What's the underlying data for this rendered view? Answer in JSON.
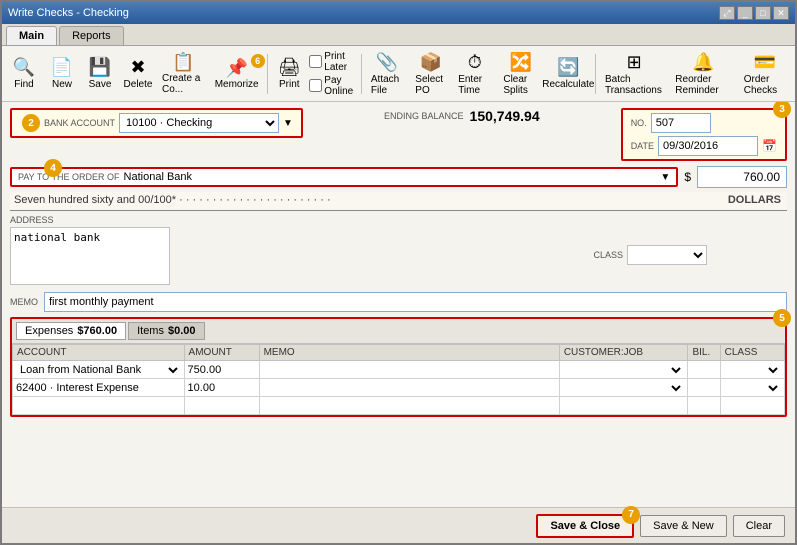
{
  "window": {
    "title": "Write Checks - Checking",
    "controls": [
      "minimize",
      "maximize",
      "close"
    ],
    "expand_icon": "⤢"
  },
  "tabs": [
    {
      "id": "main",
      "label": "Main",
      "active": true
    },
    {
      "id": "reports",
      "label": "Reports",
      "active": false
    }
  ],
  "toolbar": {
    "buttons": [
      {
        "id": "find",
        "label": "Find",
        "icon": "🔍"
      },
      {
        "id": "new",
        "label": "New",
        "icon": "📄"
      },
      {
        "id": "save",
        "label": "Save",
        "icon": "💾"
      },
      {
        "id": "delete",
        "label": "Delete",
        "icon": "✖"
      },
      {
        "id": "create-copy",
        "label": "Create a Co...",
        "icon": "📋"
      },
      {
        "id": "memorize",
        "label": "Memorize",
        "icon": "📌",
        "badge": "6"
      },
      {
        "id": "print",
        "label": "Print",
        "icon": "🖨"
      },
      {
        "id": "print-later",
        "label": "Print Later",
        "icon": ""
      },
      {
        "id": "pay-online",
        "label": "Pay Online",
        "icon": ""
      },
      {
        "id": "attach-file",
        "label": "Attach File",
        "icon": "📎"
      },
      {
        "id": "select-po",
        "label": "Select PO",
        "icon": "📦"
      },
      {
        "id": "enter-time",
        "label": "Enter Time",
        "icon": "⏱"
      },
      {
        "id": "clear-splits",
        "label": "Clear Splits",
        "icon": "🔀"
      },
      {
        "id": "recalculate",
        "label": "Recalculate",
        "icon": "🔄"
      },
      {
        "id": "batch-transactions",
        "label": "Batch Transactions",
        "icon": "⊞"
      },
      {
        "id": "reorder-reminder",
        "label": "Reorder Reminder",
        "icon": "🔔"
      },
      {
        "id": "order-checks",
        "label": "Order Checks",
        "icon": "💳"
      }
    ],
    "checkboxes": [
      {
        "id": "print-later-cb",
        "label": "Print Later",
        "checked": false
      },
      {
        "id": "pay-online-cb",
        "label": "Pay Online",
        "checked": false
      }
    ]
  },
  "form": {
    "bank_account_label": "BANK ACCOUNT",
    "bank_account_value": "10100 · Checking",
    "ending_balance_label": "ENDING BALANCE",
    "ending_balance_value": "150,749.94",
    "check_number_label": "NO.",
    "check_number_value": "507",
    "date_label": "DATE",
    "date_value": "09/30/2016",
    "pay_to_label": "PAY TO THE ORDER OF",
    "pay_to_value": "National Bank",
    "amount_dollar": "$",
    "amount_value": "760.00",
    "written_amount": "Seven hundred sixty and 00/100*  ·  ·  ·  ·  ·  ·  ·  ·  ·  ·  ·  ·  ·  ·  ·  ·  ·  ·  ·  ·  ·  ·  ·",
    "dollars_label": "DOLLARS",
    "address_label": "ADDRESS",
    "address_value": "national bank",
    "class_label": "CLASS",
    "memo_label": "MEMO",
    "memo_value": "first monthly payment"
  },
  "expenses_section": {
    "tab1_label": "Expenses",
    "tab1_amount": "$760.00",
    "tab2_label": "Items",
    "tab2_amount": "$0.00",
    "columns": [
      {
        "id": "account",
        "label": "ACCOUNT"
      },
      {
        "id": "amount",
        "label": "AMOUNT"
      },
      {
        "id": "memo",
        "label": "MEMO"
      },
      {
        "id": "customer_job",
        "label": "CUSTOMER:JOB"
      },
      {
        "id": "bil",
        "label": "BIL."
      },
      {
        "id": "class",
        "label": "CLASS"
      }
    ],
    "rows": [
      {
        "account": "Loan from National Bank",
        "amount": "750.00",
        "memo": "",
        "customer_job": "",
        "bil": "",
        "class": ""
      },
      {
        "account": "62400 · Interest Expense",
        "amount": "10.00",
        "memo": "",
        "customer_job": "",
        "bil": "",
        "class": ""
      }
    ]
  },
  "bottom_buttons": {
    "save_close_label": "Save & Close",
    "save_new_label": "Save & New",
    "clear_label": "Clear",
    "save_close_badge": "7"
  },
  "badges": {
    "memorize": "6",
    "save_close": "7",
    "bank_account_num": "2",
    "check_num": "3",
    "pay_to_num": "4",
    "expenses_num": "5"
  }
}
